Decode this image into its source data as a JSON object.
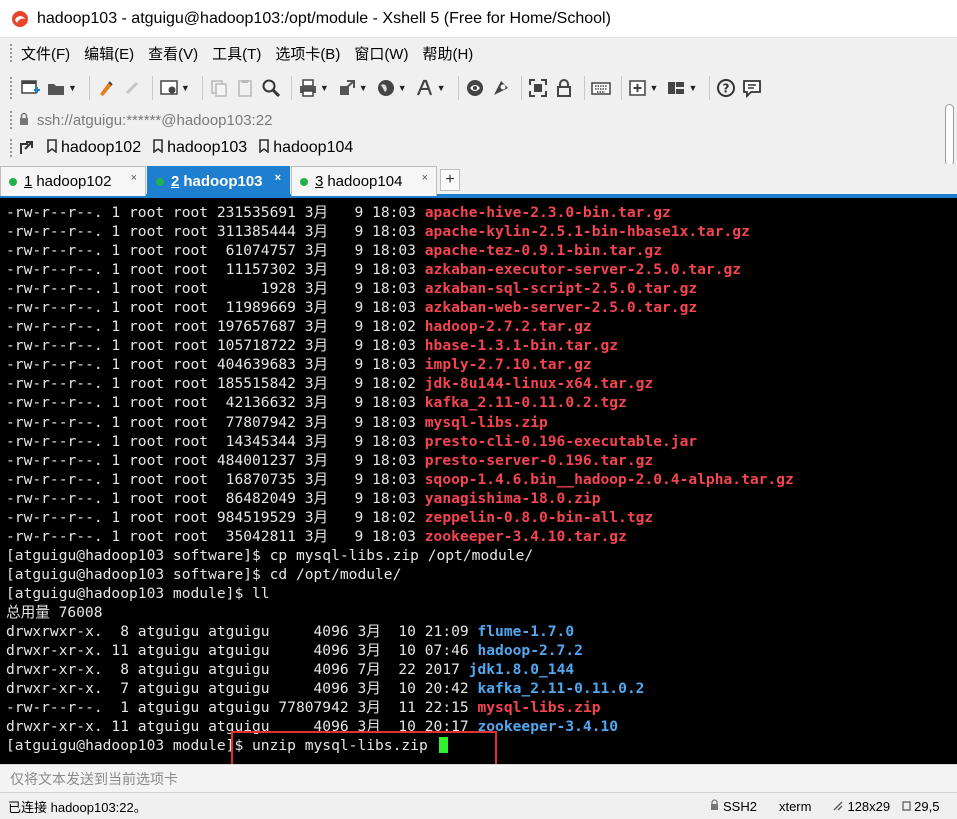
{
  "window": {
    "title": "hadoop103 - atguigu@hadoop103:/opt/module - Xshell 5 (Free for Home/School)"
  },
  "menu": {
    "items": [
      "文件(F)",
      "编辑(E)",
      "查看(V)",
      "工具(T)",
      "选项卡(B)",
      "窗口(W)",
      "帮助(H)"
    ]
  },
  "toolbar": {
    "icons": [
      "new-session-icon",
      "open-folder-icon",
      "properties-icon",
      "disconnect-icon",
      "settings-icon",
      "copy-icon",
      "paste-icon",
      "find-icon",
      "print-icon",
      "transfer-icon",
      "globe-icon",
      "font-icon",
      "script-icon",
      "record-icon",
      "fullscreen-icon",
      "lock-icon",
      "keyboard-icon",
      "new-tab-icon",
      "layout-icon",
      "help-icon",
      "chat-icon"
    ]
  },
  "address": {
    "text": "ssh://atguigu:******@hadoop103:22"
  },
  "links": {
    "items": [
      "hadoop102",
      "hadoop103",
      "hadoop104"
    ]
  },
  "tabs": [
    {
      "num": "1",
      "label": "hadoop102",
      "active": false
    },
    {
      "num": "2",
      "label": "hadoop103",
      "active": true
    },
    {
      "num": "3",
      "label": "hadoop104",
      "active": false
    }
  ],
  "terminal": {
    "lines": [
      {
        "prefix": "-rw-r--r--. 1 root root 231535691 3月   9 18:03 ",
        "name": "apache-hive-2.3.0-bin.tar.gz",
        "color": "red"
      },
      {
        "prefix": "-rw-r--r--. 1 root root 311385444 3月   9 18:03 ",
        "name": "apache-kylin-2.5.1-bin-hbase1x.tar.gz",
        "color": "red"
      },
      {
        "prefix": "-rw-r--r--. 1 root root  61074757 3月   9 18:03 ",
        "name": "apache-tez-0.9.1-bin.tar.gz",
        "color": "red"
      },
      {
        "prefix": "-rw-r--r--. 1 root root  11157302 3月   9 18:03 ",
        "name": "azkaban-executor-server-2.5.0.tar.gz",
        "color": "red"
      },
      {
        "prefix": "-rw-r--r--. 1 root root      1928 3月   9 18:03 ",
        "name": "azkaban-sql-script-2.5.0.tar.gz",
        "color": "red"
      },
      {
        "prefix": "-rw-r--r--. 1 root root  11989669 3月   9 18:03 ",
        "name": "azkaban-web-server-2.5.0.tar.gz",
        "color": "red"
      },
      {
        "prefix": "-rw-r--r--. 1 root root 197657687 3月   9 18:02 ",
        "name": "hadoop-2.7.2.tar.gz",
        "color": "red"
      },
      {
        "prefix": "-rw-r--r--. 1 root root 105718722 3月   9 18:03 ",
        "name": "hbase-1.3.1-bin.tar.gz",
        "color": "red"
      },
      {
        "prefix": "-rw-r--r--. 1 root root 404639683 3月   9 18:03 ",
        "name": "imply-2.7.10.tar.gz",
        "color": "red"
      },
      {
        "prefix": "-rw-r--r--. 1 root root 185515842 3月   9 18:02 ",
        "name": "jdk-8u144-linux-x64.tar.gz",
        "color": "red"
      },
      {
        "prefix": "-rw-r--r--. 1 root root  42136632 3月   9 18:03 ",
        "name": "kafka_2.11-0.11.0.2.tgz",
        "color": "red"
      },
      {
        "prefix": "-rw-r--r--. 1 root root  77807942 3月   9 18:03 ",
        "name": "mysql-libs.zip",
        "color": "red"
      },
      {
        "prefix": "-rw-r--r--. 1 root root  14345344 3月   9 18:03 ",
        "name": "presto-cli-0.196-executable.jar",
        "color": "red"
      },
      {
        "prefix": "-rw-r--r--. 1 root root 484001237 3月   9 18:03 ",
        "name": "presto-server-0.196.tar.gz",
        "color": "red"
      },
      {
        "prefix": "-rw-r--r--. 1 root root  16870735 3月   9 18:03 ",
        "name": "sqoop-1.4.6.bin__hadoop-2.0.4-alpha.tar.gz",
        "color": "red"
      },
      {
        "prefix": "-rw-r--r--. 1 root root  86482049 3月   9 18:03 ",
        "name": "yanagishima-18.0.zip",
        "color": "red"
      },
      {
        "prefix": "-rw-r--r--. 1 root root 984519529 3月   9 18:02 ",
        "name": "zeppelin-0.8.0-bin-all.tgz",
        "color": "red"
      },
      {
        "prefix": "-rw-r--r--. 1 root root  35042811 3月   9 18:03 ",
        "name": "zookeeper-3.4.10.tar.gz",
        "color": "red"
      },
      {
        "prefix": "[atguigu@hadoop103 software]$ cp mysql-libs.zip /opt/module/",
        "name": "",
        "color": "plain"
      },
      {
        "prefix": "[atguigu@hadoop103 software]$ cd /opt/module/",
        "name": "",
        "color": "plain"
      },
      {
        "prefix": "[atguigu@hadoop103 module]$ ll",
        "name": "",
        "color": "plain"
      },
      {
        "prefix": "总用量 76008",
        "name": "",
        "color": "plain"
      },
      {
        "prefix": "drwxrwxr-x.  8 atguigu atguigu     4096 3月  10 21:09 ",
        "name": "flume-1.7.0",
        "color": "blue"
      },
      {
        "prefix": "drwxr-xr-x. 11 atguigu atguigu     4096 3月  10 07:46 ",
        "name": "hadoop-2.7.2",
        "color": "blue"
      },
      {
        "prefix": "drwxr-xr-x.  8 atguigu atguigu     4096 7月  22 2017 ",
        "name": "jdk1.8.0_144",
        "color": "blue"
      },
      {
        "prefix": "drwxr-xr-x.  7 atguigu atguigu     4096 3月  10 20:42 ",
        "name": "kafka_2.11-0.11.0.2",
        "color": "blue"
      },
      {
        "prefix": "-rw-r--r--.  1 atguigu atguigu 77807942 3月  11 22:15 ",
        "name": "mysql-libs.zip",
        "color": "red"
      },
      {
        "prefix": "drwxr-xr-x. 11 atguigu atguigu     4096 3月  10 20:17 ",
        "name": "zookeeper-3.4.10",
        "color": "blue"
      }
    ],
    "prompt": "[atguigu@hadoop103 module]$ unzip mysql-libs.zip ",
    "colors": {
      "red": "#f5454e",
      "blue": "#52a8f0",
      "cursor": "#2ef02e"
    }
  },
  "sendbar": {
    "placeholder": "仅将文本发送到当前选项卡"
  },
  "status": {
    "connection": "已连接 hadoop103:22。",
    "protocol": "SSH2",
    "terminal_type": "xterm",
    "size": "128x29",
    "position": "29,5"
  },
  "accent": "#1e7fd1"
}
